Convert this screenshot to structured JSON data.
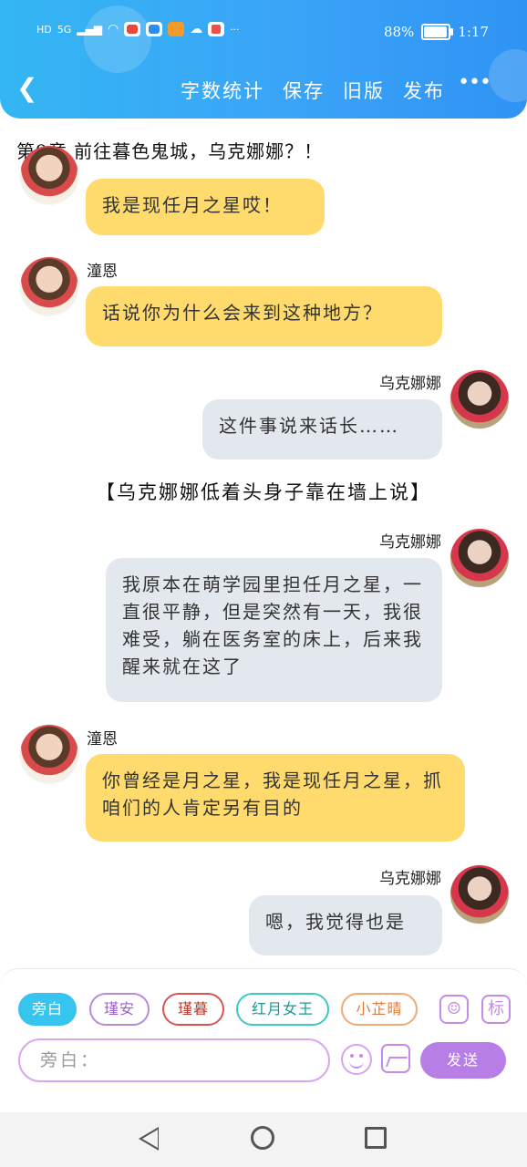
{
  "status_bar": {
    "left_badges": [
      "HD",
      "5G"
    ],
    "battery": "88%",
    "battery_level": 0.88,
    "time": "1:17",
    "overflow": "···"
  },
  "header": {
    "back_icon": "chevron-left-icon",
    "actions": [
      "字数统计",
      "保存",
      "旧版",
      "发布"
    ],
    "more": "•••"
  },
  "chapter_title": "第9章.前往暮色鬼城，乌克娜娜？！",
  "chat": [
    {
      "speaker": "",
      "side": "left",
      "text": "我是现任月之星哎！"
    },
    {
      "speaker": "潼恩",
      "side": "left",
      "text": "话说你为什么会来到这种地方？"
    },
    {
      "speaker": "乌克娜娜",
      "side": "right",
      "text": "这件事说来话长……"
    },
    {
      "narration": "【乌克娜娜低着头身子靠在墙上说】"
    },
    {
      "speaker": "乌克娜娜",
      "side": "right",
      "text": "我原本在萌学园里担任月之星，一直很平静，但是突然有一天，我很难受，躺在医务室的床上，后来我醒来就在这了"
    },
    {
      "speaker": "潼恩",
      "side": "left",
      "text": "你曾经是月之星，我是现任月之星，抓咱们的人肯定另有目的"
    },
    {
      "speaker": "乌克娜娜",
      "side": "right",
      "text": "嗯，我觉得也是"
    }
  ],
  "composer": {
    "roles": [
      "旁白",
      "瑾安",
      "瑾暮",
      "红月女王",
      "小芷晴"
    ],
    "role_icons": [
      "person-card-icon",
      "标"
    ],
    "input_placeholder": "旁白：",
    "send_label": "发送"
  }
}
